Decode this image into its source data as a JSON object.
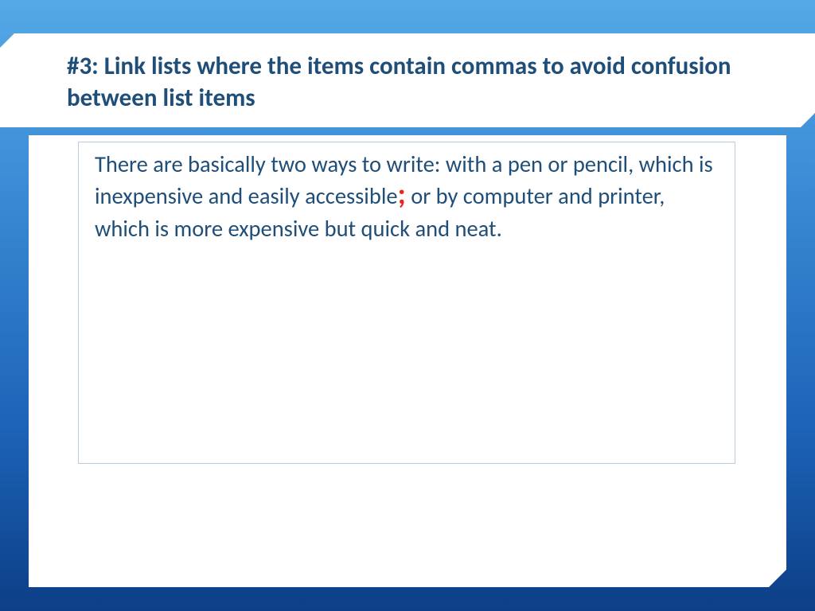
{
  "title": "#3: Link lists where the items contain commas to avoid confusion between list items",
  "body": {
    "part1": "There are basically two ways to write: with a pen or pencil, which is inexpensive and easily accessible",
    "semicolon": ";",
    "part2": " or by computer and printer, which is more expensive but quick and neat."
  }
}
